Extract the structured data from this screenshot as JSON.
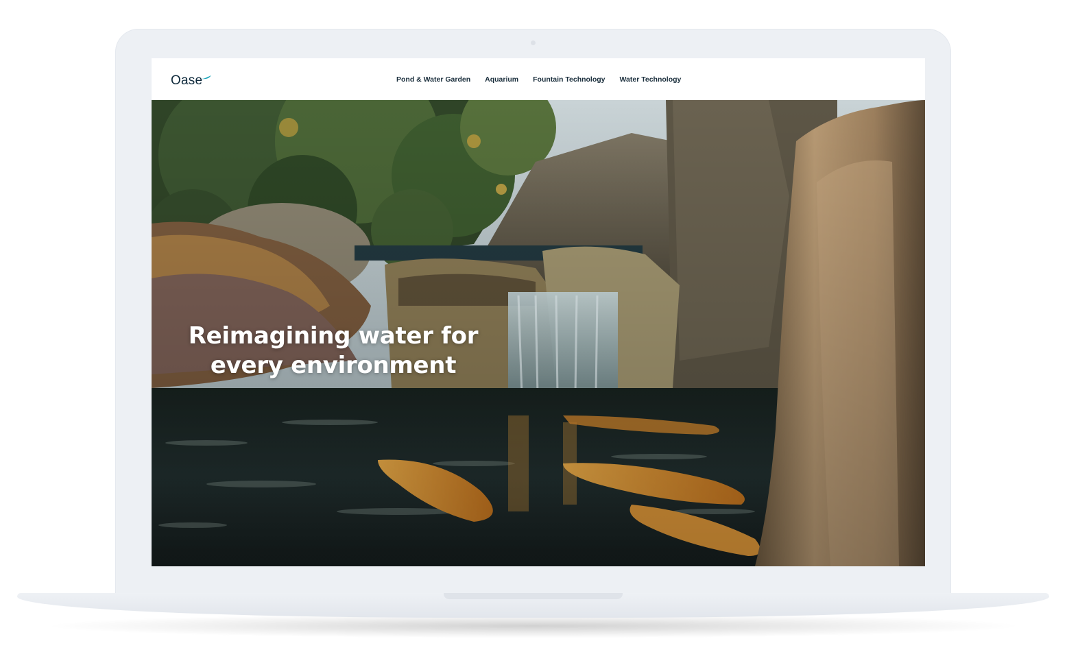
{
  "brand": {
    "name": "Oase",
    "accent": "#16a2b8"
  },
  "nav": {
    "items": [
      {
        "label": "Pond & Water Garden"
      },
      {
        "label": "Aquarium"
      },
      {
        "label": "Fountain Technology"
      },
      {
        "label": "Water Technology"
      }
    ]
  },
  "hero": {
    "headline_line1": "Reimagining water for",
    "headline_line2": "every environment"
  },
  "colors": {
    "text_dark": "#1b2f3d",
    "device_frame": "#edf0f4",
    "water": "#1d2a2b",
    "koi": "#e8a23c",
    "foliage": "#3f5a2c",
    "rock": "#8a7a62"
  }
}
